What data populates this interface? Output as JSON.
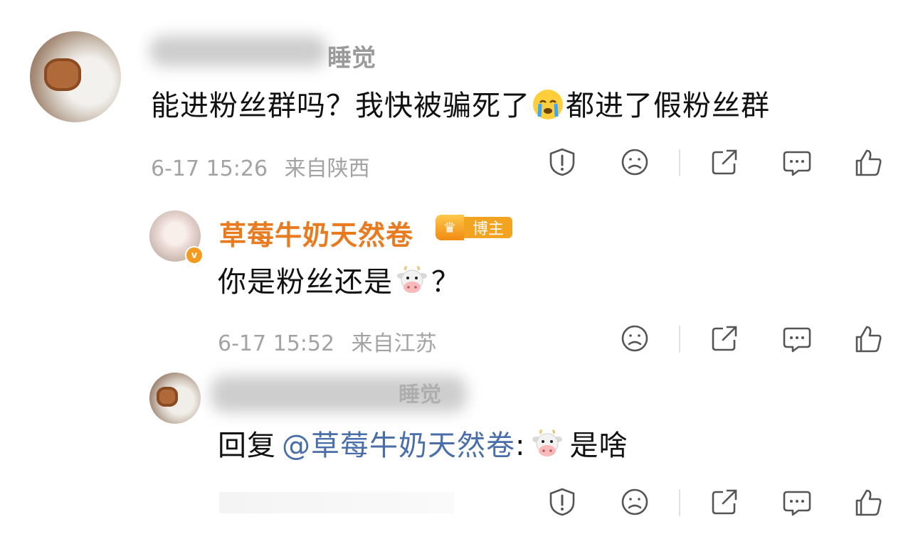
{
  "comments": [
    {
      "user_name_visible": "睡觉",
      "text": "能进粉丝群吗？我快被骗死了",
      "text_after_emoji": "都进了假粉丝群",
      "time": "6-17 15:26",
      "location": "来自陕西"
    },
    {
      "user_name": "草莓牛奶天然卷",
      "badge": "博主",
      "text_before_emoji": "你是粉丝还是",
      "text_after_emoji": "？",
      "time": "6-17 15:52",
      "location": "来自江苏"
    },
    {
      "user_name_visible": "睡觉",
      "reply_prefix": "回复",
      "mention": "@草莓牛奶天然卷",
      "colon": ":",
      "text_after_emoji": "是啥"
    }
  ],
  "icons": [
    "report-icon",
    "dislike-icon",
    "share-icon",
    "comment-icon",
    "like-icon"
  ],
  "colors": {
    "blogger_name": "#e87a1f",
    "mention": "#4a6ea9",
    "meta": "#a3a3a3",
    "badge": "#f2a320"
  }
}
